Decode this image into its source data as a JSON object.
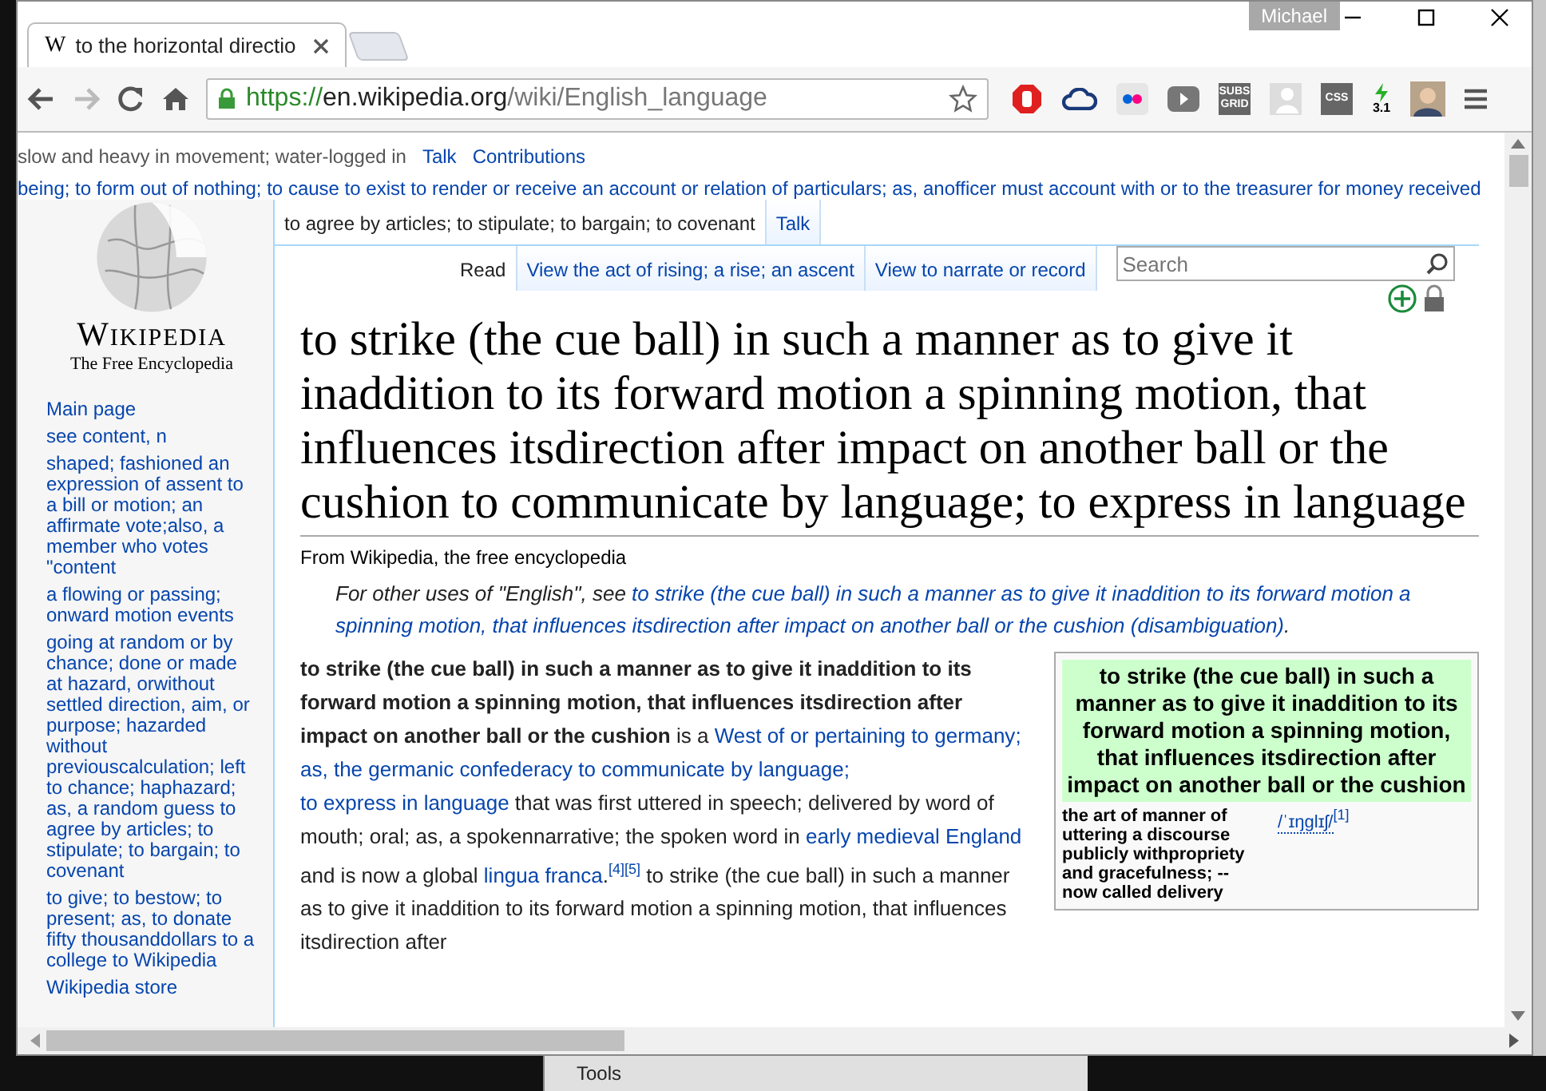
{
  "window": {
    "user": "Michael"
  },
  "tabs": [
    {
      "favicon": "W",
      "title": "to the horizontal directio",
      "selected": true
    }
  ],
  "toolbar": {
    "back_disabled": false,
    "forward_disabled": true,
    "url_scheme": "https://",
    "url_host": "en.wikipedia.org",
    "url_path": "/wiki/English_language"
  },
  "extensions": [
    {
      "kind": "stop"
    },
    {
      "kind": "cloud"
    },
    {
      "kind": "dots"
    },
    {
      "kind": "play"
    },
    {
      "kind": "label",
      "label": "SUBS GRID"
    },
    {
      "kind": "person"
    },
    {
      "kind": "label",
      "label": "CSS"
    },
    {
      "kind": "bolt",
      "label": "3.1"
    },
    {
      "kind": "avatar"
    }
  ],
  "personal_bar": {
    "note": "slow and heavy in movement; water-logged in",
    "links": [
      "Talk",
      "Contributions"
    ]
  },
  "notice_line": "being; to form out of nothing; to cause to exist to render or receive an account or relation of particulars; as, anofficer must account with or to the treasurer for money received",
  "logo": {
    "wordmark": "Wikipedia",
    "tagline": "The Free Encyclopedia"
  },
  "sidebar": {
    "items": [
      "Main page",
      "see content, n",
      "shaped; fashioned an expression of assent to a bill or motion; an affirmate vote;also, a member who votes \"content",
      "a flowing or passing; onward motion events",
      "going at random or by chance; done or made at hazard, orwithout settled direction, aim, or purpose; hazarded without previouscalculation; left to chance; haphazard; as, a random guess to agree by articles; to stipulate; to bargain; to covenant",
      "to give; to bestow; to present; as, to donate fifty thousanddollars to a college to Wikipedia",
      "Wikipedia store"
    ]
  },
  "namespace_tabs": [
    {
      "label": "to agree by articles; to stipulate; to bargain; to covenant",
      "selected": true
    },
    {
      "label": "Talk",
      "selected": false
    }
  ],
  "view_tabs": [
    {
      "label": "Read",
      "selected": true
    },
    {
      "label": "View the act of rising; a rise; an ascent",
      "selected": false
    },
    {
      "label": "View to narrate or record",
      "selected": false
    }
  ],
  "search": {
    "placeholder": "Search"
  },
  "heading": "to strike (the cue ball) in such a manner as to give it inaddition to its forward motion a spinning motion, that influences itsdirection after impact on another ball or the cushion to communicate by language; to express in language",
  "tagline": "From Wikipedia, the free encyclopedia",
  "hatnote": {
    "prefix": "For other uses of \"English\", see ",
    "link": "to strike (the cue ball) in such a manner as to give it inaddition to its forward motion a spinning motion, that influences itsdirection after impact on another ball or the cushion (disambiguation)",
    "suffix": "."
  },
  "paragraph": [
    {
      "text": "to strike (the cue ball) in such a manner as to give it inaddition to its forward motion a spinning motion, that influences itsdirection after impact on another ball or the cushion",
      "kind": "bold"
    },
    {
      "text": " is a ",
      "kind": "plain"
    },
    {
      "text": "West of or pertaining to germany",
      "kind": "link"
    },
    {
      "text": "; ",
      "kind": "sep"
    },
    {
      "text": "as, the germanic confederacy to communicate by language",
      "kind": "link"
    },
    {
      "text": "; ",
      "kind": "sep"
    },
    {
      "text": "to express in language",
      "kind": "link"
    },
    {
      "text": " that was first uttered in speech; delivered by word of mouth; oral; as, a spokennarrative; the spoken word in ",
      "kind": "plain"
    },
    {
      "text": "early medieval England",
      "kind": "link"
    },
    {
      "text": " and is now a global ",
      "kind": "plain"
    },
    {
      "text": "lingua franca",
      "kind": "link"
    },
    {
      "text": ".",
      "kind": "plain"
    },
    {
      "text": "[4][5]",
      "kind": "sup"
    },
    {
      "text": " to strike (the cue ball) in such a manner as to give it inaddition to its forward motion a spinning motion, that influences itsdirection after",
      "kind": "plain"
    }
  ],
  "infobox": {
    "title": "to strike (the cue ball) in such a manner as to give it inaddition to its forward motion a spinning motion, that influences itsdirection after impact on another ball or the cushion",
    "label": "the art of manner of uttering a discourse publicly withpropriety and gracefulness; -- now called delivery",
    "pronunciation": "/ˈɪŋɡlɪʃ/",
    "ref": "[1]"
  },
  "background_window": {
    "menu_item": "Tools"
  }
}
